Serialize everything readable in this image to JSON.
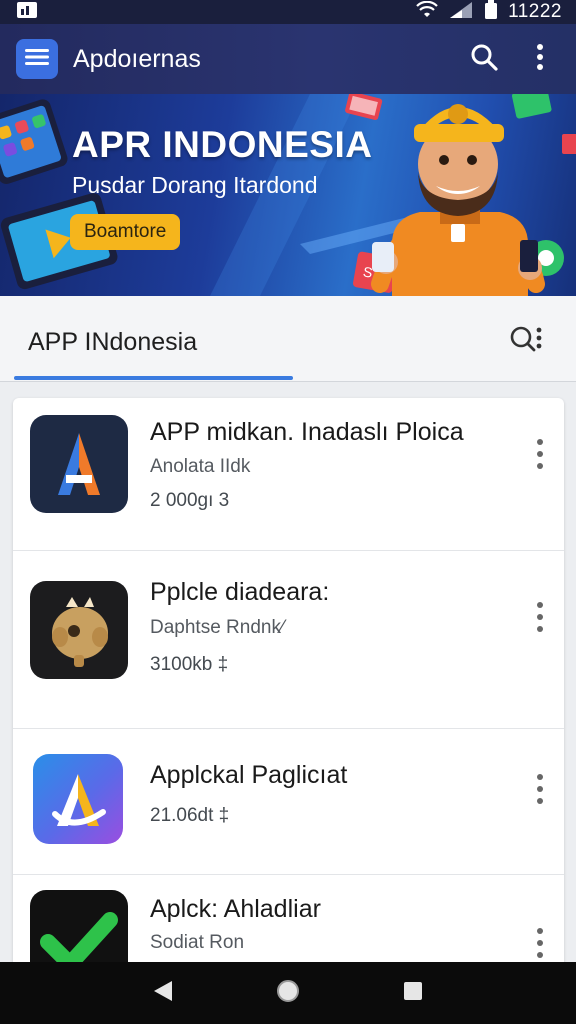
{
  "status_bar": {
    "time": "11222",
    "icons": [
      "notification-icon",
      "wifi-icon",
      "signal-icon",
      "battery-icon"
    ]
  },
  "app_bar": {
    "title": "Apdoıernas",
    "icons": [
      "menu-icon",
      "search-icon",
      "more-vert-icon"
    ]
  },
  "banner": {
    "title": "APR INDONESIA",
    "subtitle": "Pusdar Dorang Itardond",
    "button_label": "Boamtore"
  },
  "tab": {
    "label": "APP INdonesia",
    "icons": [
      "search-more-icon"
    ]
  },
  "apps": [
    {
      "title": "APP midkan. Inadaslı Ploica",
      "subtitle": "Anolata IIdk",
      "meta": "2 000ɡı 3",
      "icon": "letter-a-orange-icon"
    },
    {
      "title": "Pplcle diadeara:",
      "subtitle": "Daphtse Rndnk⁄",
      "meta": "3100kb ‡",
      "icon": "gold-creature-icon"
    },
    {
      "title": "Applckal Paglicıat",
      "subtitle": "",
      "meta": "21.06dt ‡",
      "icon": "letter-a-gradient-icon"
    },
    {
      "title": "Aplck: Ahladliar",
      "subtitle": "Sodiat Ron",
      "meta": "",
      "icon": "green-check-icon"
    }
  ],
  "nav": [
    "back-icon",
    "home-icon",
    "recents-icon"
  ],
  "colors": {
    "app_bar": "#2a3470",
    "accent": "#3a7be0",
    "banner_button": "#f5b51c",
    "nav_bar": "#0b0b0b"
  }
}
